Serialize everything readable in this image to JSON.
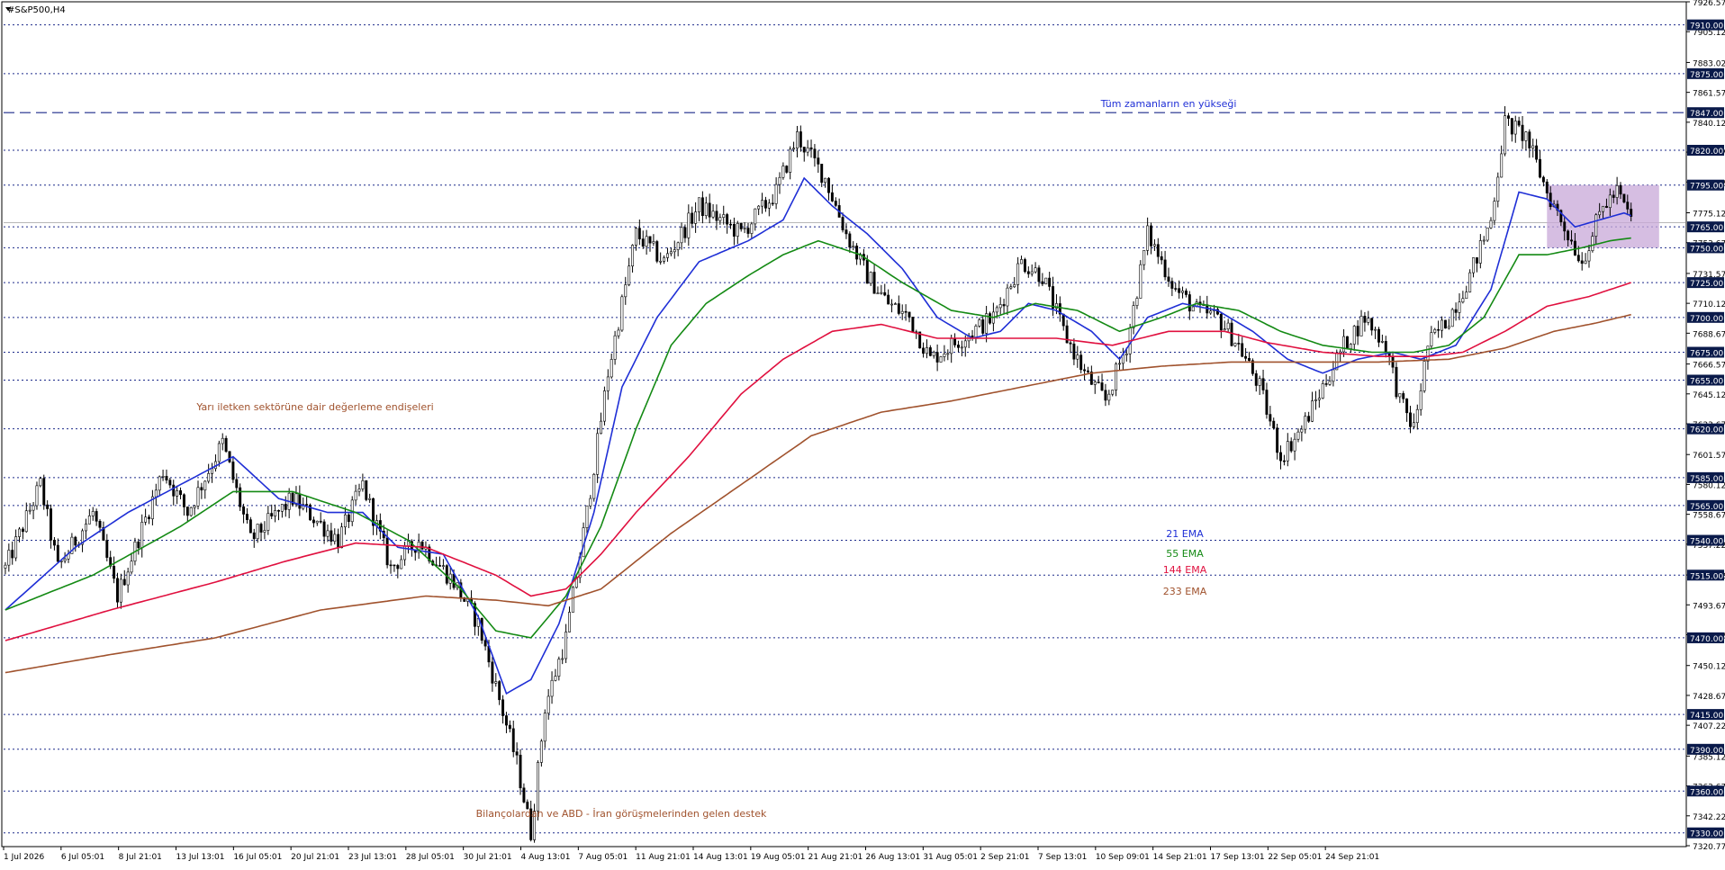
{
  "chart_data": {
    "type": "candlestick",
    "symbol_label": "#S&P500,H4",
    "y_range": [
      7320.77,
      7926.57
    ],
    "price_ticks": [
      7926.57,
      7905.12,
      7883.02,
      7861.57,
      7840.12,
      7818.67,
      7797.22,
      7775.12,
      7753.67,
      7731.57,
      7710.12,
      7688.67,
      7666.57,
      7645.12,
      7623.67,
      7601.57,
      7580.12,
      7558.67,
      7537.22,
      7515.12,
      7493.67,
      7472.22,
      7450.12,
      7428.67,
      7407.22,
      7385.12,
      7363.67,
      7342.22,
      7320.77
    ],
    "levels": [
      7910,
      7875,
      7820,
      7795,
      7765,
      7750,
      7725,
      7700,
      7675,
      7655,
      7620,
      7585,
      7565,
      7540,
      7515,
      7470,
      7415,
      7390,
      7360,
      7330
    ],
    "level_labels": [
      "7910.00",
      "7875.00",
      "7820.00",
      "7795.00",
      "7765.00",
      "7750.00",
      "7725.00",
      "7700.00",
      "7675.00",
      "7655.00",
      "7620.00",
      "7585.00",
      "7565.00",
      "7540.00",
      "7515.00",
      "7470.00",
      "7415.00",
      "7390.00",
      "7360.00",
      "7330.00"
    ],
    "all_time_high": {
      "value": 7847,
      "label": "7847.00"
    },
    "current_price_line": 7768,
    "x_labels": [
      "1 Jul 2026",
      "6 Jul 05:01",
      "8 Jul 21:01",
      "13 Jul 13:01",
      "16 Jul 05:01",
      "20 Jul 21:01",
      "23 Jul 13:01",
      "28 Jul 05:01",
      "30 Jul 21:01",
      "4 Aug 13:01",
      "7 Aug 05:01",
      "11 Aug 21:01",
      "14 Aug 13:01",
      "19 Aug 05:01",
      "21 Aug 21:01",
      "26 Aug 13:01",
      "31 Aug 05:01",
      "2 Sep 21:01",
      "7 Sep 13:01",
      "10 Sep 09:01",
      "14 Sep 21:01",
      "17 Sep 13:01",
      "22 Sep 05:01",
      "24 Sep 21:01"
    ],
    "anchors": [
      [
        0,
        7520
      ],
      [
        10,
        7580
      ],
      [
        15,
        7520
      ],
      [
        25,
        7560
      ],
      [
        32,
        7500
      ],
      [
        45,
        7590
      ],
      [
        52,
        7560
      ],
      [
        62,
        7610
      ],
      [
        70,
        7540
      ],
      [
        82,
        7570
      ],
      [
        95,
        7540
      ],
      [
        102,
        7580
      ],
      [
        110,
        7520
      ],
      [
        118,
        7540
      ],
      [
        128,
        7510
      ],
      [
        135,
        7480
      ],
      [
        140,
        7435
      ],
      [
        146,
        7380
      ],
      [
        150,
        7330
      ],
      [
        154,
        7420
      ],
      [
        160,
        7470
      ],
      [
        166,
        7560
      ],
      [
        172,
        7660
      ],
      [
        180,
        7760
      ],
      [
        188,
        7740
      ],
      [
        198,
        7780
      ],
      [
        210,
        7760
      ],
      [
        220,
        7790
      ],
      [
        226,
        7830
      ],
      [
        234,
        7800
      ],
      [
        240,
        7760
      ],
      [
        246,
        7730
      ],
      [
        252,
        7710
      ],
      [
        258,
        7700
      ],
      [
        264,
        7670
      ],
      [
        270,
        7680
      ],
      [
        276,
        7690
      ],
      [
        282,
        7700
      ],
      [
        290,
        7740
      ],
      [
        296,
        7730
      ],
      [
        302,
        7690
      ],
      [
        308,
        7660
      ],
      [
        314,
        7640
      ],
      [
        320,
        7680
      ],
      [
        326,
        7760
      ],
      [
        334,
        7720
      ],
      [
        340,
        7705
      ],
      [
        346,
        7700
      ],
      [
        352,
        7680
      ],
      [
        358,
        7650
      ],
      [
        364,
        7600
      ],
      [
        370,
        7620
      ],
      [
        376,
        7650
      ],
      [
        382,
        7680
      ],
      [
        388,
        7700
      ],
      [
        394,
        7680
      ],
      [
        398,
        7640
      ],
      [
        402,
        7620
      ],
      [
        406,
        7680
      ],
      [
        412,
        7700
      ],
      [
        418,
        7730
      ],
      [
        424,
        7770
      ],
      [
        428,
        7840
      ],
      [
        434,
        7830
      ],
      [
        440,
        7790
      ],
      [
        446,
        7760
      ],
      [
        450,
        7740
      ],
      [
        456,
        7780
      ],
      [
        460,
        7790
      ],
      [
        464,
        7770
      ]
    ],
    "ema_anchors": {
      "21": [
        [
          0,
          7490
        ],
        [
          20,
          7535
        ],
        [
          35,
          7560
        ],
        [
          50,
          7580
        ],
        [
          65,
          7600
        ],
        [
          78,
          7570
        ],
        [
          92,
          7560
        ],
        [
          102,
          7560
        ],
        [
          112,
          7535
        ],
        [
          125,
          7530
        ],
        [
          135,
          7485
        ],
        [
          143,
          7430
        ],
        [
          150,
          7440
        ],
        [
          158,
          7480
        ],
        [
          168,
          7560
        ],
        [
          176,
          7650
        ],
        [
          186,
          7700
        ],
        [
          198,
          7740
        ],
        [
          212,
          7755
        ],
        [
          222,
          7770
        ],
        [
          228,
          7800
        ],
        [
          236,
          7780
        ],
        [
          246,
          7760
        ],
        [
          256,
          7735
        ],
        [
          266,
          7700
        ],
        [
          276,
          7685
        ],
        [
          284,
          7690
        ],
        [
          292,
          7710
        ],
        [
          300,
          7705
        ],
        [
          310,
          7690
        ],
        [
          318,
          7670
        ],
        [
          326,
          7700
        ],
        [
          336,
          7710
        ],
        [
          346,
          7705
        ],
        [
          356,
          7690
        ],
        [
          366,
          7670
        ],
        [
          376,
          7660
        ],
        [
          386,
          7670
        ],
        [
          396,
          7675
        ],
        [
          404,
          7670
        ],
        [
          414,
          7680
        ],
        [
          424,
          7720
        ],
        [
          432,
          7790
        ],
        [
          440,
          7785
        ],
        [
          448,
          7765
        ],
        [
          455,
          7770
        ],
        [
          462,
          7775
        ],
        [
          464,
          7773
        ]
      ],
      "55": [
        [
          0,
          7490
        ],
        [
          25,
          7515
        ],
        [
          50,
          7550
        ],
        [
          65,
          7575
        ],
        [
          82,
          7575
        ],
        [
          100,
          7560
        ],
        [
          115,
          7540
        ],
        [
          130,
          7505
        ],
        [
          140,
          7475
        ],
        [
          150,
          7470
        ],
        [
          160,
          7500
        ],
        [
          170,
          7550
        ],
        [
          180,
          7620
        ],
        [
          190,
          7680
        ],
        [
          200,
          7710
        ],
        [
          212,
          7730
        ],
        [
          222,
          7745
        ],
        [
          232,
          7755
        ],
        [
          244,
          7745
        ],
        [
          256,
          7725
        ],
        [
          270,
          7705
        ],
        [
          282,
          7700
        ],
        [
          294,
          7710
        ],
        [
          306,
          7705
        ],
        [
          318,
          7690
        ],
        [
          330,
          7700
        ],
        [
          340,
          7710
        ],
        [
          352,
          7705
        ],
        [
          364,
          7690
        ],
        [
          376,
          7680
        ],
        [
          390,
          7675
        ],
        [
          402,
          7675
        ],
        [
          412,
          7680
        ],
        [
          422,
          7700
        ],
        [
          432,
          7745
        ],
        [
          440,
          7745
        ],
        [
          450,
          7750
        ],
        [
          458,
          7755
        ],
        [
          464,
          7757
        ]
      ],
      "144": [
        [
          0,
          7468
        ],
        [
          30,
          7490
        ],
        [
          60,
          7510
        ],
        [
          80,
          7525
        ],
        [
          100,
          7538
        ],
        [
          120,
          7535
        ],
        [
          140,
          7515
        ],
        [
          150,
          7500
        ],
        [
          160,
          7505
        ],
        [
          170,
          7530
        ],
        [
          180,
          7560
        ],
        [
          195,
          7600
        ],
        [
          210,
          7645
        ],
        [
          222,
          7670
        ],
        [
          236,
          7690
        ],
        [
          250,
          7695
        ],
        [
          266,
          7685
        ],
        [
          282,
          7685
        ],
        [
          300,
          7685
        ],
        [
          316,
          7680
        ],
        [
          332,
          7690
        ],
        [
          348,
          7690
        ],
        [
          360,
          7682
        ],
        [
          376,
          7675
        ],
        [
          392,
          7672
        ],
        [
          406,
          7672
        ],
        [
          416,
          7675
        ],
        [
          428,
          7690
        ],
        [
          440,
          7708
        ],
        [
          452,
          7715
        ],
        [
          464,
          7725
        ]
      ],
      "233": [
        [
          0,
          7445
        ],
        [
          30,
          7458
        ],
        [
          60,
          7470
        ],
        [
          90,
          7490
        ],
        [
          120,
          7500
        ],
        [
          140,
          7497
        ],
        [
          155,
          7493
        ],
        [
          170,
          7505
        ],
        [
          190,
          7545
        ],
        [
          210,
          7580
        ],
        [
          230,
          7615
        ],
        [
          250,
          7632
        ],
        [
          270,
          7640
        ],
        [
          290,
          7650
        ],
        [
          310,
          7660
        ],
        [
          330,
          7665
        ],
        [
          350,
          7668
        ],
        [
          372,
          7668
        ],
        [
          392,
          7668
        ],
        [
          412,
          7670
        ],
        [
          428,
          7678
        ],
        [
          442,
          7690
        ],
        [
          454,
          7696
        ],
        [
          464,
          7702
        ]
      ]
    },
    "ema_colors": {
      "21": "#1f2fd6",
      "55": "#148a14",
      "144": "#e0103f",
      "233": "#a0522d"
    },
    "ema_legend": [
      {
        "label": "21 EMA",
        "color": "#1f2fd6"
      },
      {
        "label": "55 EMA",
        "color": "#148a14"
      },
      {
        "label": "144 EMA",
        "color": "#e0103f"
      },
      {
        "label": "233 EMA",
        "color": "#a0522d"
      }
    ],
    "annotations": {
      "ath": "Tüm zamanların en yükseği",
      "semis": "Yarı iletken sektörüne dair değerleme endişeleri",
      "support": "Bilançolardan ve ABD - İran görüşmelerinden gelen destek"
    },
    "zone": {
      "from_bar": 440,
      "to_bar": 472,
      "low": 7750,
      "high": 7795,
      "color": "#c8a8d8"
    },
    "colors": {
      "level_line": "#1c2a8a",
      "annotation_brown": "#a0522d",
      "annotation_blue": "#1f2fd6",
      "candle": "#000000",
      "label_box": "#0a1a4a"
    }
  }
}
